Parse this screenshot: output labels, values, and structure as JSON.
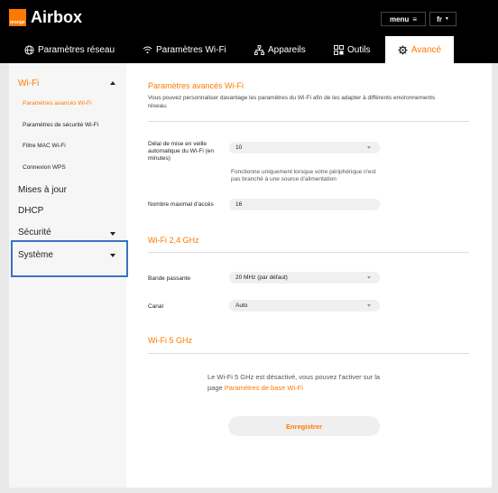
{
  "header": {
    "brand_small": "orange",
    "app_title": "Airbox",
    "menu_label": "menu",
    "lang_label": "fr"
  },
  "nav": {
    "tabs": [
      {
        "label": "Paramètres réseau",
        "icon": "globe-icon"
      },
      {
        "label": "Paramètres Wi-Fi",
        "icon": "wifi-icon"
      },
      {
        "label": "Appareils",
        "icon": "devices-icon"
      },
      {
        "label": "Outils",
        "icon": "tools-icon"
      },
      {
        "label": "Avancé",
        "icon": "gear-icon",
        "active": true
      }
    ]
  },
  "sidebar": {
    "wifi": "Wi-Fi",
    "sub": [
      "Paramètres avancés Wi-Fi",
      "Paramètres de sécurité Wi-Fi",
      "Filtre MAC Wi-Fi",
      "Connexion WPS"
    ],
    "items": [
      "Mises à jour",
      "DHCP",
      "Sécurité",
      "Système"
    ]
  },
  "content": {
    "title": "Paramètres avancés Wi-Fi",
    "description": "Vous pouvez personnaliser davantage les paramètres du Wi-Fi afin de les adapter à différents environnements réseau.",
    "sleep_label": "Délai de mise en veille automatique du Wi-Fi (en minutes)",
    "sleep_value": "10",
    "sleep_note": "Fonctionne uniquement lorsque votre périphérique n'est pas branché à une source d'alimentation",
    "max_access_label": "Nombre maximal d'accès",
    "max_access_value": "16",
    "wifi24_title": "Wi-Fi 2,4 GHz",
    "bandwidth_label": "Bande passante",
    "bandwidth_value": "20 MHz (par défaut)",
    "channel_label": "Canal",
    "channel_value": "Auto",
    "wifi5_title": "Wi-Fi 5 GHz",
    "wifi5_info": "Le Wi-Fi 5 GHz est désactivé, vous pouvez l'activer sur la page",
    "wifi5_link": "Paramètres de base Wi-Fi",
    "save_label": "Enregistrer"
  },
  "colors": {
    "accent": "#ff7900",
    "header_bg": "#000000",
    "highlight_box": "#3b72c4"
  }
}
